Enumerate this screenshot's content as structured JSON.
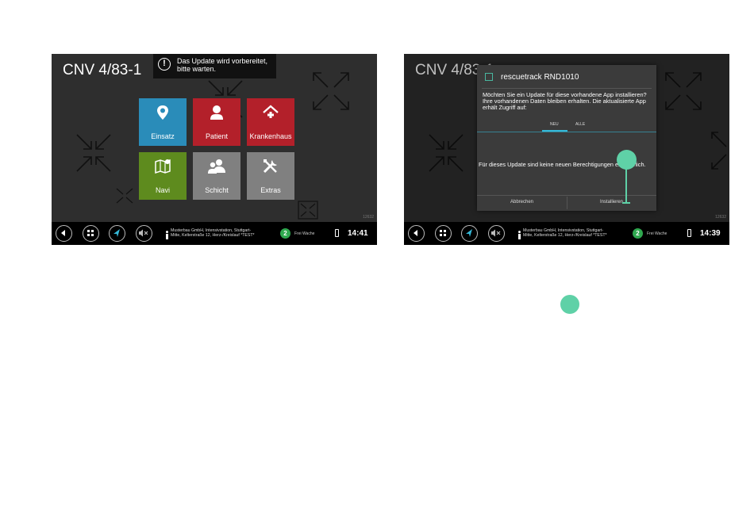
{
  "left_screen": {
    "app_title": "CNV 4/83-1",
    "toast": {
      "text_line1": "Das Update wird vorbereitet,",
      "text_line2": "bitte warten.",
      "icon": "exclamation-icon"
    },
    "tiles": [
      {
        "label": "Einsatz",
        "icon": "map-pin-icon",
        "color": "#2a8cb9"
      },
      {
        "label": "Patient",
        "icon": "person-icon",
        "color": "#b3202a"
      },
      {
        "label": "Krankenhaus",
        "icon": "hospital-house-icon",
        "color": "#b3202a"
      },
      {
        "label": "Navi",
        "icon": "map-icon",
        "color": "#5e8b1e"
      },
      {
        "label": "Schicht",
        "icon": "people-icon",
        "color": "#808080"
      },
      {
        "label": "Extras",
        "icon": "tools-icon",
        "color": "#808080"
      }
    ],
    "corner_number": "12632",
    "taskbar": {
      "address_line1": "Musterbau GmbH, Intensivstation, Stuttgart-",
      "address_line2": "Mitte, Kelterstraße 12, Herz-/Kreislauf *TEST*",
      "count": "2",
      "status": "Frei Wache",
      "time": "14:41"
    }
  },
  "right_screen": {
    "app_title": "CNV 4/83-1",
    "dialog": {
      "title": "rescuetrack RND1010",
      "message": "Möchten Sie ein Update für diese vorhandene App installieren? Ihre vorhandenen Daten bleiben erhalten. Die aktualisierte App erhält Zugriff auf:",
      "tab_new": "NEU",
      "tab_all": "ALLE",
      "body": "Für dieses Update sind keine neuen Berechtigungen erforderlich.",
      "cancel_label": "Abbrechen",
      "install_label": "Installieren"
    },
    "corner_number": "12632",
    "taskbar": {
      "address_line1": "Musterbau GmbH, Intensivstation, Stuttgart-",
      "address_line2": "Mitte, Kelterstraße 12, Herz-/Kreislauf *TEST*",
      "count": "2",
      "status": "Frei Wache",
      "time": "14:39"
    }
  },
  "colors": {
    "accent_teal": "#5fd1a7",
    "tab_blue": "#35b9d9",
    "status_green": "#2fa84f",
    "screen_bg": "#2e2e2e"
  }
}
